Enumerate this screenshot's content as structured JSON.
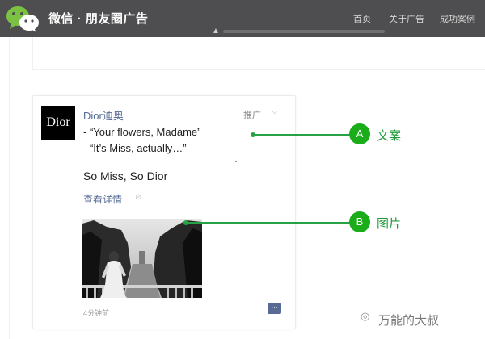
{
  "header": {
    "brand": "微信 · 朋友圈广告",
    "nav": [
      "首页",
      "关于广告",
      "成功案例"
    ]
  },
  "post": {
    "avatar_text": "Dior",
    "account_name": "Dior迪奥",
    "sponsored_label": "推广",
    "copy_lines": [
      "- “Your flowers, Madame”",
      "- “It’s Miss, actually…”"
    ],
    "tagline": "So Miss, So Dior",
    "details_link": "查看详情",
    "timestamp": "4分钟前"
  },
  "callouts": [
    {
      "badge": "A",
      "label": "文案"
    },
    {
      "badge": "B",
      "label": "图片"
    }
  ],
  "watermark": "万能的大叔",
  "colors": {
    "header_bg": "#4e4e50",
    "link_blue": "#576b95",
    "wechat_green": "#1aad19"
  }
}
